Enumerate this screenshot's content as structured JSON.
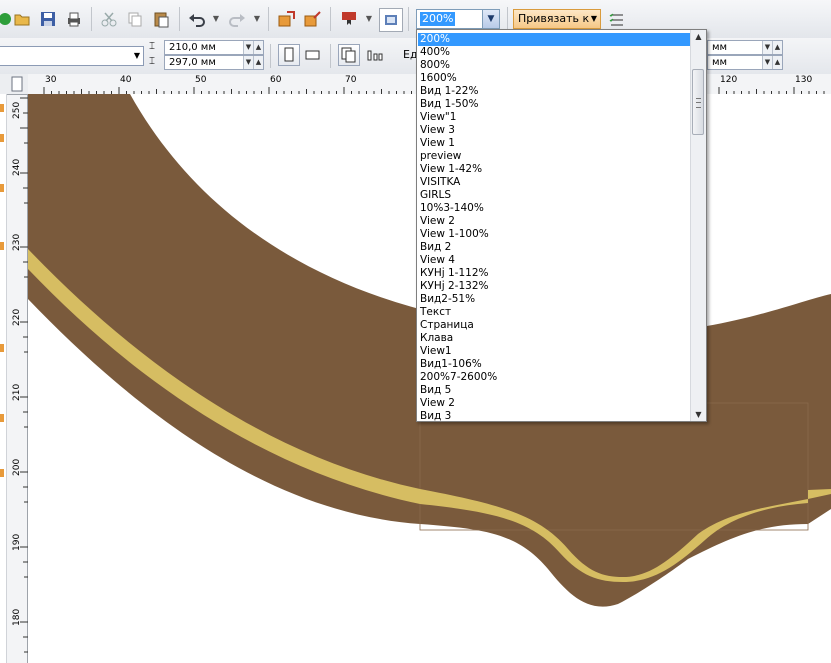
{
  "toolbar": {
    "zoom_value": "200%",
    "snap_label": "Привязать к",
    "icons": [
      "new-icon",
      "open-icon",
      "save-icon",
      "print-icon",
      "cut-icon",
      "copy-icon",
      "paste-icon",
      "undo-icon",
      "redo-icon",
      "import-icon",
      "export-icon",
      "publish-pdf-icon",
      "app-launcher-icon",
      "snap-options-icon"
    ]
  },
  "property_bar": {
    "page_width": "210,0 мм",
    "page_height": "297,0 мм",
    "units_label": "Ед",
    "nudge_x": "мм",
    "nudge_y": "мм"
  },
  "rulers": {
    "horizontal_labels": [
      "30",
      "40",
      "50",
      "60",
      "70",
      "120",
      "130"
    ],
    "vertical_labels": [
      "240",
      "230",
      "220",
      "210",
      "200",
      "190",
      "180"
    ],
    "corner_label": "250"
  },
  "zoom_list": {
    "items": [
      "200%",
      "400%",
      "800%",
      "1600%",
      "Вид 1-22%",
      "Вид 1-50%",
      "View\"1",
      "View 3",
      "View 1",
      "preview",
      "View 1-42%",
      "VISITKA",
      "GIRLS",
      "10%3-140%",
      "View 2",
      "View 1-100%",
      "Вид 2",
      "View 4",
      "КУНј 1-112%",
      "КУНј 2-132%",
      "Вид2-51%",
      "Текст",
      "Страница",
      "Клава",
      "View1",
      "Вид1-106%",
      "200%7-2600%",
      "Вид 5",
      " View 2",
      "Вид 3"
    ],
    "selected_index": 0
  },
  "colors": {
    "band_brown": "#7a5a3c",
    "stripe_gold": "#d6bd62",
    "selection": "#3399ff"
  }
}
